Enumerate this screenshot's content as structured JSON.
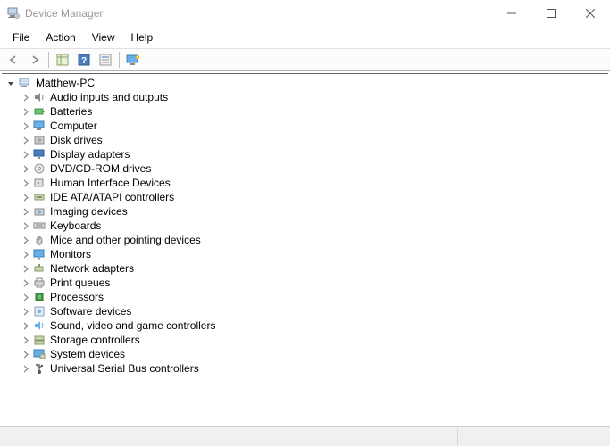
{
  "window": {
    "title": "Device Manager"
  },
  "menus": {
    "file": "File",
    "action": "Action",
    "view": "View",
    "help": "Help"
  },
  "tree": {
    "root": "Matthew-PC",
    "categories": [
      {
        "label": "Audio inputs and outputs",
        "icon": "speaker"
      },
      {
        "label": "Batteries",
        "icon": "battery"
      },
      {
        "label": "Computer",
        "icon": "computer"
      },
      {
        "label": "Disk drives",
        "icon": "disk"
      },
      {
        "label": "Display adapters",
        "icon": "display"
      },
      {
        "label": "DVD/CD-ROM drives",
        "icon": "dvd"
      },
      {
        "label": "Human Interface Devices",
        "icon": "hid"
      },
      {
        "label": "IDE ATA/ATAPI controllers",
        "icon": "ide"
      },
      {
        "label": "Imaging devices",
        "icon": "imaging"
      },
      {
        "label": "Keyboards",
        "icon": "keyboard"
      },
      {
        "label": "Mice and other pointing devices",
        "icon": "mouse"
      },
      {
        "label": "Monitors",
        "icon": "monitor"
      },
      {
        "label": "Network adapters",
        "icon": "network"
      },
      {
        "label": "Print queues",
        "icon": "printer"
      },
      {
        "label": "Processors",
        "icon": "cpu"
      },
      {
        "label": "Software devices",
        "icon": "software"
      },
      {
        "label": "Sound, video and game controllers",
        "icon": "sound"
      },
      {
        "label": "Storage controllers",
        "icon": "storage"
      },
      {
        "label": "System devices",
        "icon": "system"
      },
      {
        "label": "Universal Serial Bus controllers",
        "icon": "usb"
      }
    ]
  }
}
